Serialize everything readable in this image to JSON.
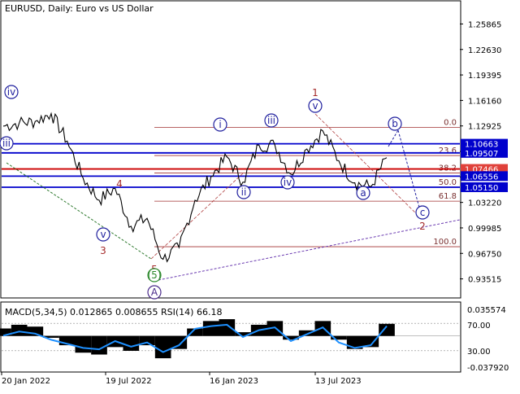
{
  "header": {
    "symbol_line": "EURUSD, Daily:  Euro vs US Dollar"
  },
  "indicator": {
    "caption": "MACD(5,34,5) 0.012865 0.008655 RSI(14) 66.18",
    "scale_labels": [
      "0.035574",
      "70.00",
      "30.00",
      "-0.037920"
    ]
  },
  "chart_data": [
    {
      "type": "line",
      "title": "EURUSD, Daily:  Euro vs US Dollar",
      "price_axis_labels": [
        "1.25865",
        "1.22630",
        "1.19395",
        "1.16160",
        "1.12925",
        "1.09690",
        "1.06455",
        "1.03220",
        "0.99985",
        "0.96750",
        "0.93515"
      ],
      "ylim": [
        0.912,
        1.287
      ],
      "time_axis_labels": [
        "20 Jan 2022",
        "19 Jul 2022",
        "16 Jan 2023",
        "13 Jul 2023"
      ],
      "price_series": {
        "x": [
          "2021-11",
          "2021-12",
          "2022-01",
          "2022-02",
          "2022-03",
          "2022-04",
          "2022-05",
          "2022-06",
          "2022-07",
          "2022-08",
          "2022-09",
          "2022-10",
          "2022-11",
          "2022-12",
          "2023-01",
          "2023-02",
          "2023-03",
          "2023-04",
          "2023-05",
          "2023-06",
          "2023-07",
          "2023-08",
          "2023-09",
          "2023-10",
          "2023-11"
        ],
        "y": [
          1.129,
          1.133,
          1.135,
          1.145,
          1.11,
          1.063,
          1.035,
          1.05,
          1.002,
          1.012,
          0.96,
          0.975,
          1.035,
          1.065,
          1.09,
          1.058,
          1.105,
          1.105,
          1.068,
          1.1,
          1.123,
          1.085,
          1.057,
          1.052,
          1.089
        ]
      },
      "horizontal_levels": [
        {
          "label": "1.10663",
          "value": 1.10663,
          "color": "#0000cc",
          "label_bg": "#0000cc"
        },
        {
          "label": "1.09507",
          "value": 1.09507,
          "color": "#0000cc",
          "label_bg": "#0000cc"
        },
        {
          "label": "1.07466",
          "value": 1.07466,
          "color": "#cc0000",
          "label_bg": "#e0413a"
        },
        {
          "label": "1.06556",
          "value": 1.06556,
          "color": "#0000cc",
          "label_bg": "#0000cc"
        },
        {
          "label": "1.05150",
          "value": 1.0515,
          "color": "#0000cc",
          "label_bg": "#0000cc"
        }
      ],
      "fibonacci_levels": [
        {
          "label": "0.0",
          "value": 1.1275
        },
        {
          "label": "23.6",
          "value": 1.0917
        },
        {
          "label": "38.2",
          "value": 1.0695
        },
        {
          "label": "50.0",
          "value": 1.0517
        },
        {
          "label": "61.8",
          "value": 1.0338
        },
        {
          "label": "100.0",
          "value": 0.976
        }
      ],
      "wave_labels": [
        "iv",
        "iii",
        "v",
        "3",
        "4",
        "5",
        "(5)",
        "A",
        "i",
        "ii",
        "iii",
        "iv",
        "v",
        "1",
        "a",
        "b",
        "c",
        "2"
      ],
      "colors": {
        "price_line": "#000000",
        "wave_blue": "#1f1f9e",
        "wave_red": "#a52a2a",
        "fib": "#a03030",
        "trend": "#6a3ab0"
      }
    },
    {
      "type": "area",
      "title": "MACD(5,34,5) 0.012865 0.008655 RSI(14) 66.18",
      "ylim": [
        -0.03792,
        0.035574
      ],
      "rsi_levels": [
        70,
        30
      ],
      "series": [
        {
          "name": "MACD",
          "values": [
            0.008,
            0.012,
            0.01,
            -0.002,
            -0.01,
            -0.018,
            -0.02,
            -0.012,
            -0.016,
            -0.01,
            -0.024,
            -0.014,
            0.008,
            0.016,
            0.018,
            0.004,
            0.012,
            0.016,
            -0.004,
            0.006,
            0.016,
            -0.004,
            -0.014,
            -0.012,
            0.013
          ]
        },
        {
          "name": "RSI(14)",
          "values": [
            52,
            58,
            55,
            46,
            40,
            34,
            32,
            44,
            36,
            42,
            28,
            38,
            62,
            66,
            68,
            50,
            60,
            64,
            44,
            54,
            64,
            42,
            34,
            38,
            66
          ]
        }
      ]
    }
  ]
}
